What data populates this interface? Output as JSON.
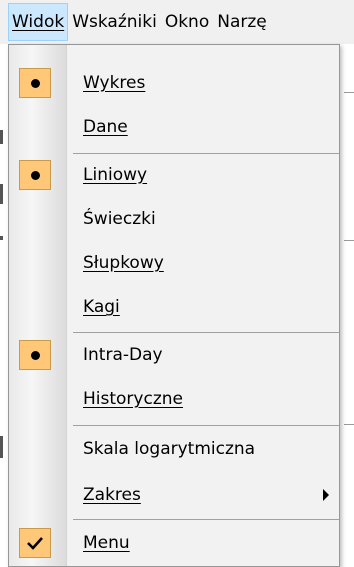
{
  "menubar": {
    "items": [
      {
        "label": "Widok",
        "active": true
      },
      {
        "label": "Wskaźniki",
        "active": false
      },
      {
        "label": "Okno",
        "active": false
      },
      {
        "label": "Narzę",
        "active": false
      }
    ]
  },
  "dropdown": {
    "items": [
      {
        "label": "Wykres",
        "mark": "radio-dot"
      },
      {
        "label": "Dane",
        "mark": "none"
      },
      {
        "label": "Liniowy",
        "mark": "radio-dot"
      },
      {
        "label": "Świeczki",
        "mark": "none"
      },
      {
        "label": "Słupkowy",
        "mark": "none"
      },
      {
        "label": "Kagi",
        "mark": "none"
      },
      {
        "label": "Intra-Day",
        "mark": "radio-dot"
      },
      {
        "label": "Historyczne",
        "mark": "none"
      },
      {
        "label": "Skala logarytmiczna",
        "mark": "none"
      },
      {
        "label": "Zakres",
        "mark": "none",
        "submenu": true
      },
      {
        "label": "Menu",
        "mark": "checkmark"
      }
    ]
  },
  "colors": {
    "check_bg": "#ffc878",
    "active_menu_bg": "#cce8ff",
    "menu_bg": "#f2f2f2"
  }
}
